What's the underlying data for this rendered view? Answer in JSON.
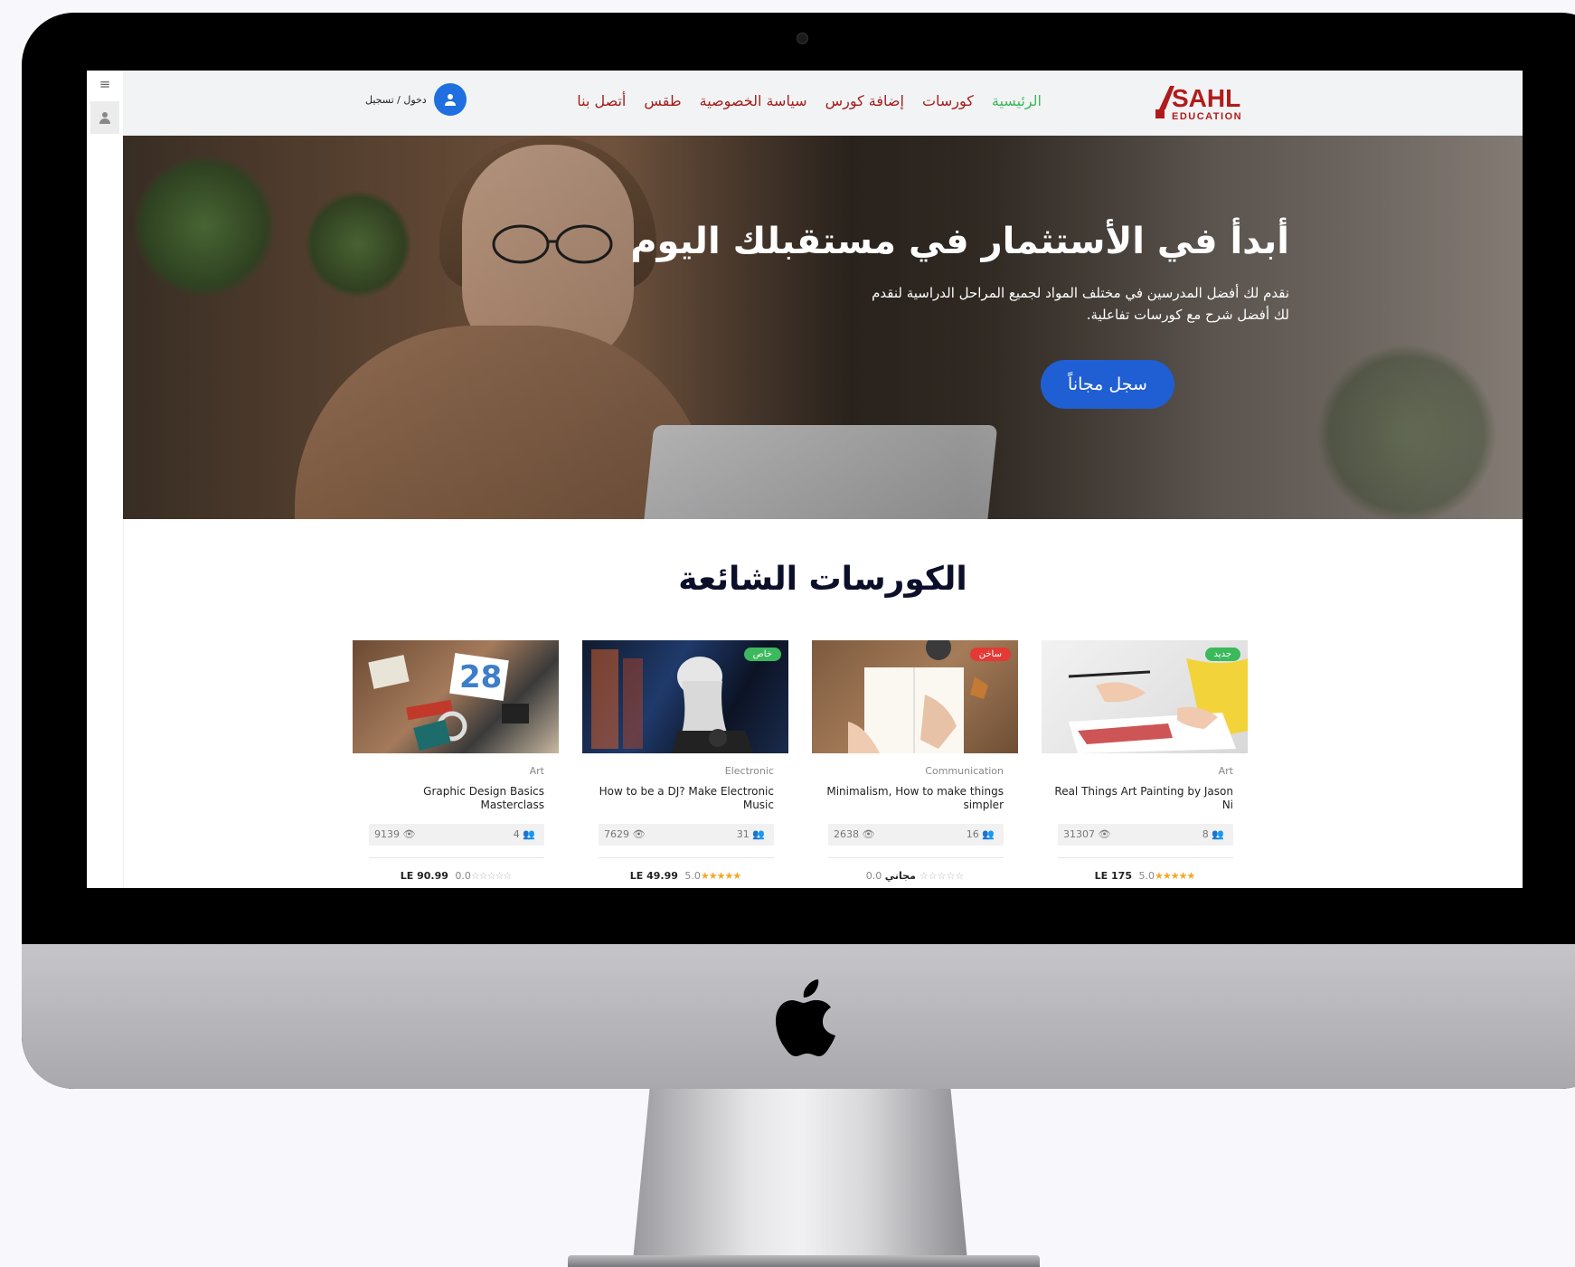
{
  "header": {
    "logo_text": "SAHL",
    "logo_sub": "EDUCATION",
    "nav": [
      {
        "label": "الرئيسية",
        "active": true
      },
      {
        "label": "كورسات",
        "active": false
      },
      {
        "label": "إضافة كورس",
        "active": false
      },
      {
        "label": "سياسة الخصوصية",
        "active": false
      },
      {
        "label": "طقس",
        "active": false
      },
      {
        "label": "أتصل بنا",
        "active": false
      }
    ],
    "login_label": "دخول / تسجيل"
  },
  "hero": {
    "title": "أبدأ في الأستثمار في مستقبلك اليوم",
    "subtitle": "نقدم لك أفضل المدرسين في مختلف المواد لجميع المراحل الدراسية لنقدم لك أفضل شرح مع كورسات تفاعلية.",
    "cta_label": "سجل مجاناً"
  },
  "popular": {
    "title": "الكورسات الشائعة",
    "cards": [
      {
        "badge": "جديد",
        "badge_color": "#3cb95c",
        "category": "Art",
        "title": "Real Things Art Painting by Jason Ni",
        "views": "31307",
        "students": "8",
        "price": "LE 175",
        "rating": "5.0",
        "stars": 5
      },
      {
        "badge": "ساخن",
        "badge_color": "#e53935",
        "category": "Communication",
        "title": "Minimalism, How to make things simpler",
        "views": "2638",
        "students": "16",
        "price": "مجاني",
        "rating": "0.0",
        "stars": 0
      },
      {
        "badge": "خاص",
        "badge_color": "#3cb95c",
        "category": "Electronic",
        "title": "How to be a DJ? Make Electronic Music",
        "views": "7629",
        "students": "31",
        "price": "LE 49.99",
        "rating": "5.0",
        "stars": 5
      },
      {
        "badge": "",
        "badge_color": "",
        "category": "Art",
        "title": "Graphic Design Basics Masterclass",
        "views": "9139",
        "students": "4",
        "price": "LE 90.99",
        "rating": "0.0",
        "stars": 0
      }
    ]
  },
  "colors": {
    "nav_text": "#a51d1d",
    "nav_active": "#3cb95c",
    "primary_blue": "#1f5fd3",
    "star": "#f5a623"
  }
}
